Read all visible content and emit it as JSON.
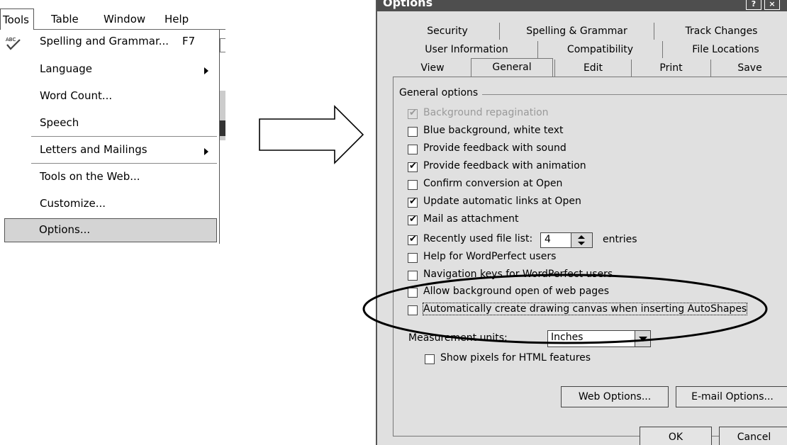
{
  "menu": {
    "menubar": [
      "Tools",
      "Table",
      "Window",
      "Help"
    ],
    "items": [
      {
        "label": "Spelling and Grammar...",
        "shortcut": "F7",
        "icon": "abc-check-icon"
      },
      {
        "label": "Language",
        "submenu": true
      },
      {
        "label": "Word Count..."
      },
      {
        "label": "Speech"
      },
      {
        "label": "Letters and Mailings",
        "submenu": true
      },
      {
        "label": "Tools on the Web..."
      },
      {
        "label": "Customize..."
      },
      {
        "label": "Options...",
        "selected": true
      }
    ]
  },
  "dialog": {
    "title": "Options",
    "title_buttons": [
      "?",
      "×"
    ],
    "tabs_row1": [
      "Security",
      "Spelling & Grammar",
      "Track Changes"
    ],
    "tabs_row2": [
      "User Information",
      "Compatibility",
      "File Locations"
    ],
    "tabs_row3": [
      "View",
      "General",
      "Edit",
      "Print",
      "Save"
    ],
    "active_tab": "General",
    "group_label": "General options",
    "options": [
      {
        "label": "Background repagination",
        "checked": true,
        "disabled": true
      },
      {
        "label": "Blue background, white text",
        "checked": false
      },
      {
        "label": "Provide feedback with sound",
        "checked": false
      },
      {
        "label": "Provide feedback with animation",
        "checked": true
      },
      {
        "label": "Confirm conversion at Open",
        "checked": false
      },
      {
        "label": "Update automatic links at Open",
        "checked": true
      },
      {
        "label": "Mail as attachment",
        "checked": true
      },
      {
        "label": "Recently used file list:",
        "checked": true
      },
      {
        "label": "Help for WordPerfect users",
        "checked": false
      },
      {
        "label": "Navigation keys for WordPerfect users",
        "checked": false
      },
      {
        "label": "Allow background open of web pages",
        "checked": false
      },
      {
        "label": "Automatically create drawing canvas when inserting AutoShapes",
        "checked": false,
        "focused": true
      }
    ],
    "recent_files_count": "4",
    "entries_label": "entries",
    "measurement_label": "Measurement units:",
    "measurement_value": "Inches",
    "show_pixels_label": "Show pixels for HTML features",
    "show_pixels_checked": false,
    "web_options_button": "Web Options...",
    "email_options_button": "E-mail Options...",
    "ok_button": "OK",
    "cancel_button": "Cancel"
  }
}
